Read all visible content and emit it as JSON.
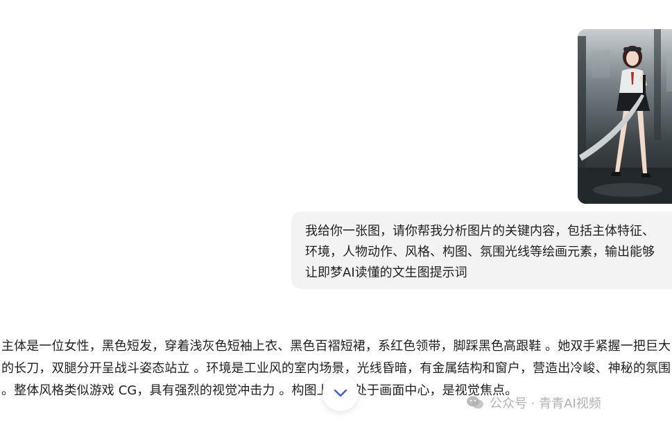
{
  "conversation": {
    "user_message": "我给你一张图，请你帮我分析图片的关键内容，包括主体特征、环境，人物动作、风格、构图、氛围光线等绘画元素，输出能够让即梦AI读懂的文生图提示词",
    "assistant_message": "主体是一位女性，黑色短发，穿着浅灰色短袖上衣、黑色百褶短裙，系红色领带，脚踩黑色高跟鞋 。她双手紧握一把巨大的长刀，双腿分开呈战斗姿态站立 。环境是工业风的室内场景，光线昏暗，有金属结构和窗户，营造出冷峻、神秘的氛围 。整体风格类似游戏 CG，具有强烈的视觉冲击力 。构图上人物处于画面中心，是视觉焦点。"
  },
  "watermark": {
    "text": "公众号 · 青青AI视频"
  },
  "icons": {
    "scroll_down": "chevron-down-icon",
    "watermark_logo": "wechat-logo-icon"
  },
  "colors": {
    "bubble_bg": "#f3f3f4",
    "scroll_chevron": "#3b5bdb"
  }
}
